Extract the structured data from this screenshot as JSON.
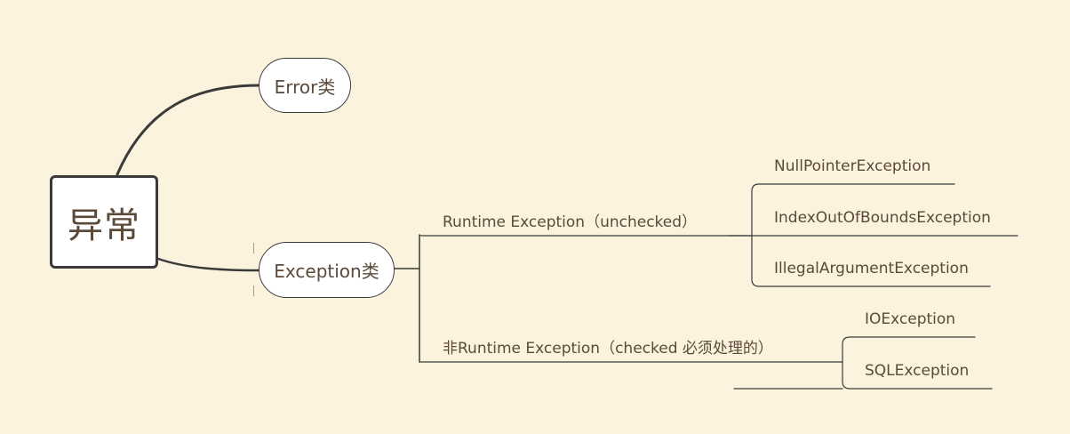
{
  "root": {
    "label": "异常"
  },
  "error_node": {
    "label": "Error类"
  },
  "exception_node": {
    "label": "Exception类"
  },
  "branches": {
    "runtime": {
      "label": "Runtime Exception（unchecked）",
      "children": [
        "NullPointerException",
        "IndexOutOfBoundsException",
        "IllegalArgumentException"
      ]
    },
    "non_runtime": {
      "label": "非Runtime Exception（checked 必须处理的）",
      "children": [
        "IOException",
        "SQLException"
      ]
    }
  },
  "colors": {
    "background": "#fbf3dd",
    "line": "#3a3a3a",
    "text": "#5b4a3a"
  }
}
